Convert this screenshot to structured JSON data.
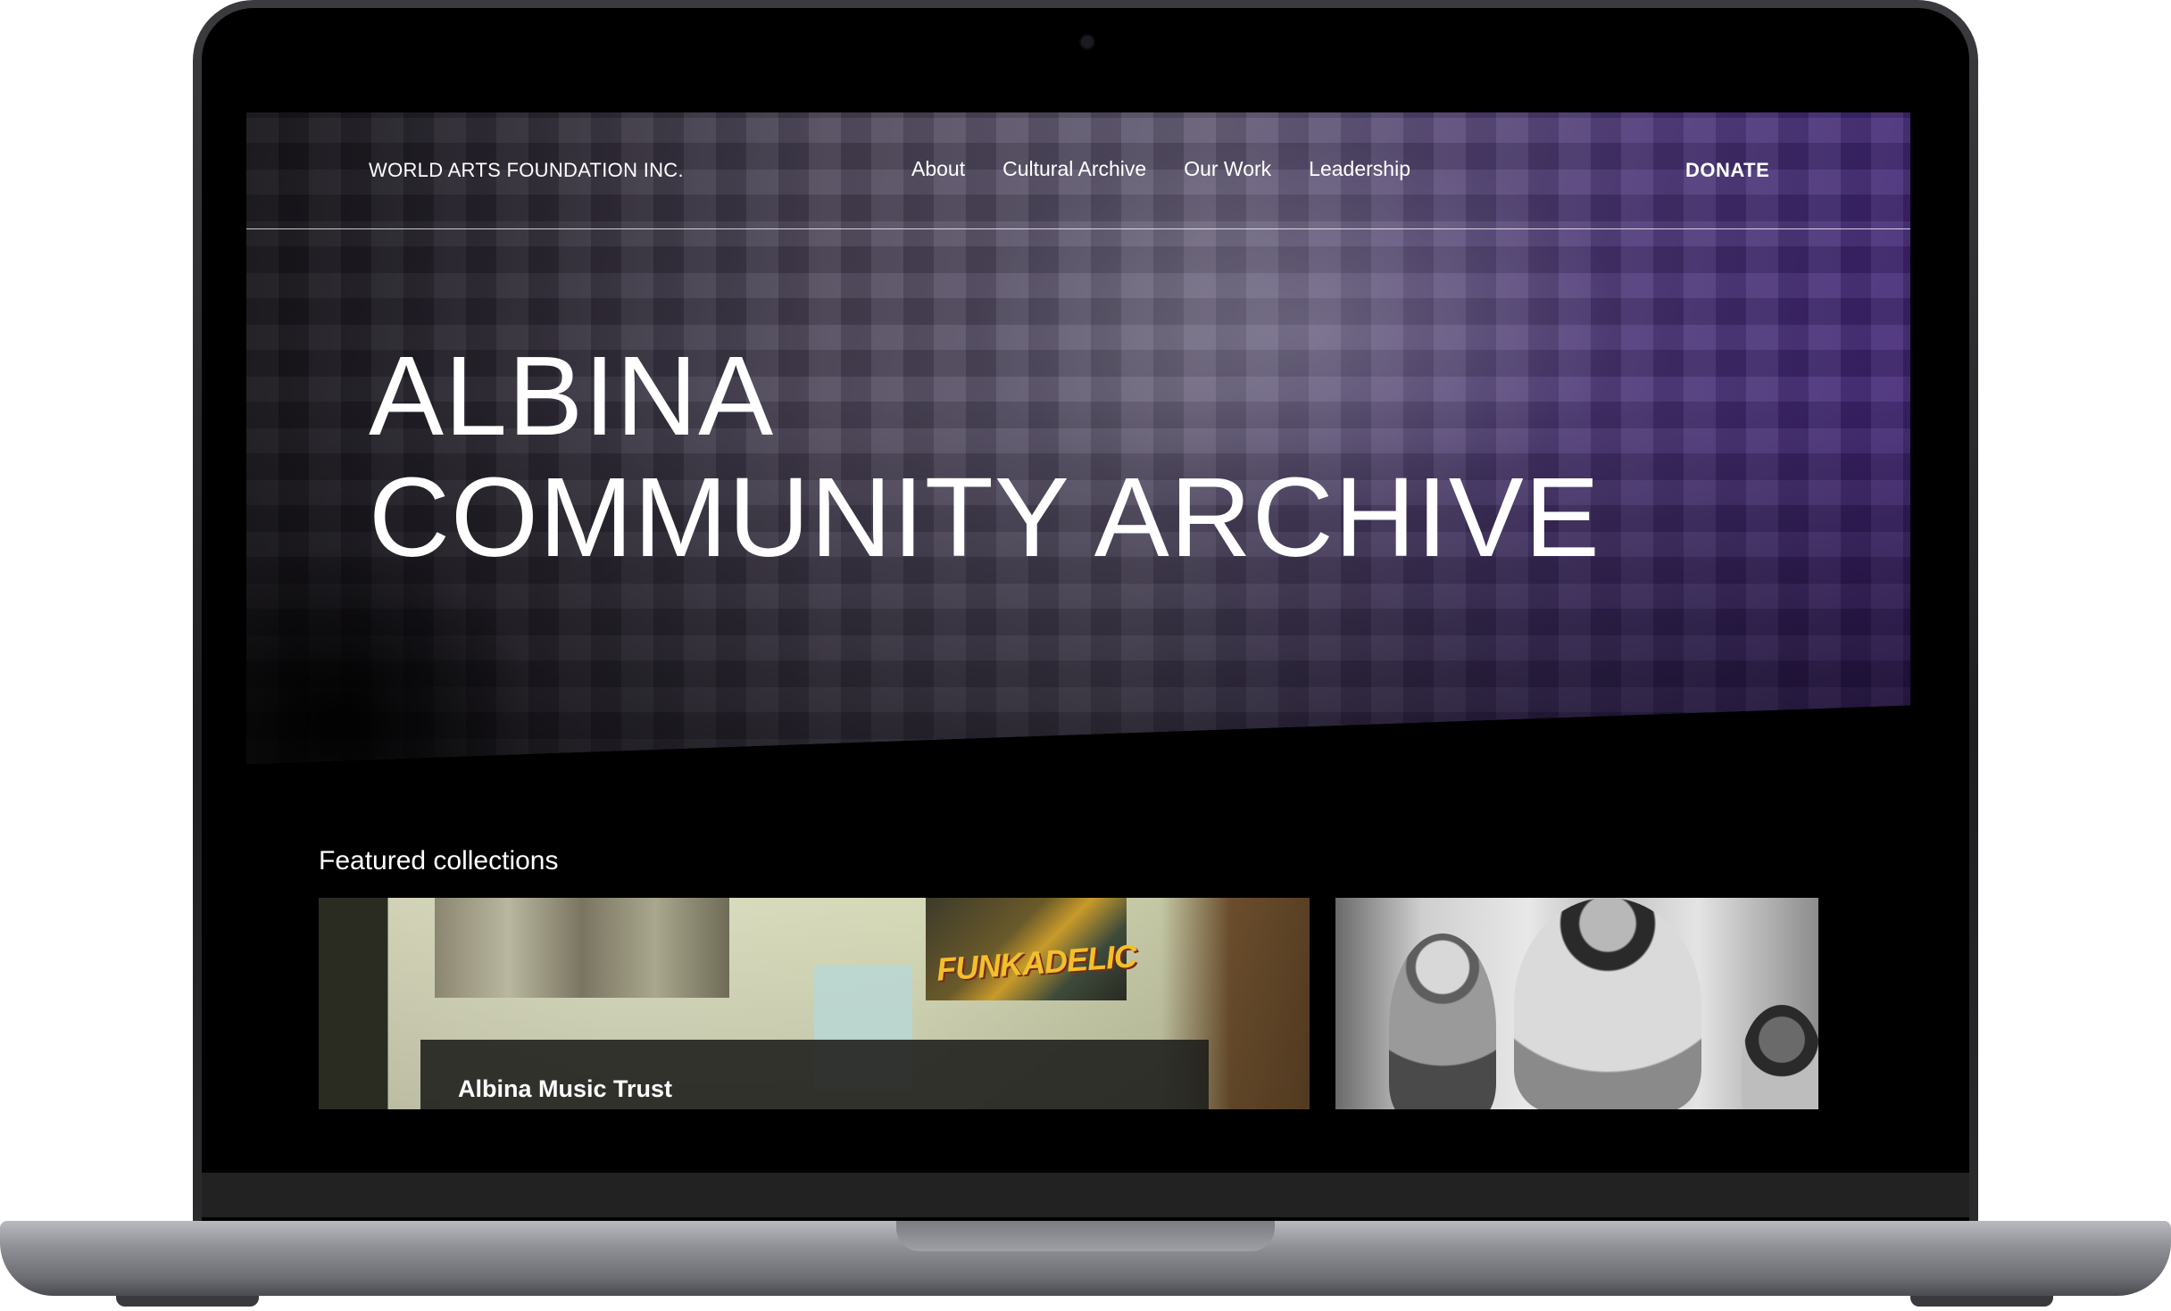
{
  "site": {
    "brand": "WORLD ARTS FOUNDATION INC.",
    "nav": [
      "About",
      "Cultural Archive",
      "Our Work",
      "Leadership"
    ],
    "donate": "DONATE"
  },
  "hero": {
    "title_line1": "ALBINA",
    "title_line2": "COMMUNITY ARCHIVE"
  },
  "featured": {
    "heading": "Featured collections",
    "cards": [
      {
        "label": "Albina Music Trust",
        "poster_text": "FUNKADELIC"
      },
      {
        "label": ""
      }
    ]
  },
  "colors": {
    "background": "#000000",
    "accent_purple": "#3c1f72",
    "text": "#ffffff"
  }
}
